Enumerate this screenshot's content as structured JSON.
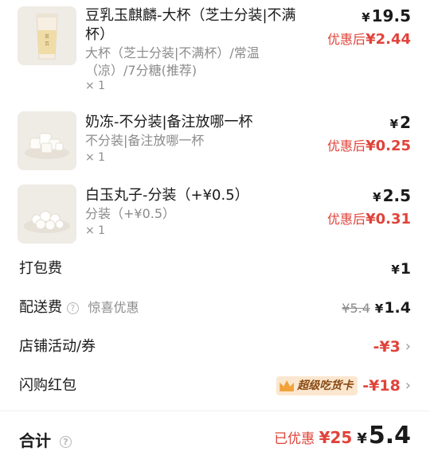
{
  "items": [
    {
      "title": "豆乳玉麒麟-大杯（芝士分装|不满杯）",
      "spec": "大杯（芝士分装|不满杯）/常温（凉）/7分糖(推荐)",
      "qty": "× 1",
      "price_symbol": "¥",
      "price": "19.5",
      "discount_label": "优惠后",
      "discount_value": "¥2.44",
      "thumb_icon": "milk-tea-cup-icon"
    },
    {
      "title": "奶冻-不分装|备注放哪一杯",
      "spec": "不分装|备注放哪一杯",
      "qty": "× 1",
      "price_symbol": "¥",
      "price": "2",
      "discount_label": "优惠后",
      "discount_value": "¥0.25",
      "thumb_icon": "milk-jelly-icon"
    },
    {
      "title": "白玉丸子-分装（+¥0.5）",
      "spec": "分装（+¥0.5）",
      "qty": "× 1",
      "price_symbol": "¥",
      "price": "2.5",
      "discount_label": "优惠后",
      "discount_value": "¥0.31",
      "thumb_icon": "rice-balls-icon"
    }
  ],
  "fees": {
    "packing_label": "打包费",
    "packing_symbol": "¥",
    "packing_value": "1",
    "delivery_label": "配送费",
    "delivery_note": "惊喜优惠",
    "delivery_original": "¥5.4",
    "delivery_symbol": "¥",
    "delivery_value": "1.4",
    "store_label": "店铺活动/券",
    "store_value": "-¥3",
    "flash_label": "闪购红包",
    "flash_badge": "超级吃货卡",
    "flash_value": "-¥18"
  },
  "total": {
    "label": "合计",
    "saved_label": "已优惠",
    "saved_value": "¥25",
    "symbol": "¥",
    "value": "5.4"
  },
  "colors": {
    "accent_red": "#e0433a",
    "badge_bg": "#fbe7cf",
    "badge_text": "#8a4a12"
  }
}
